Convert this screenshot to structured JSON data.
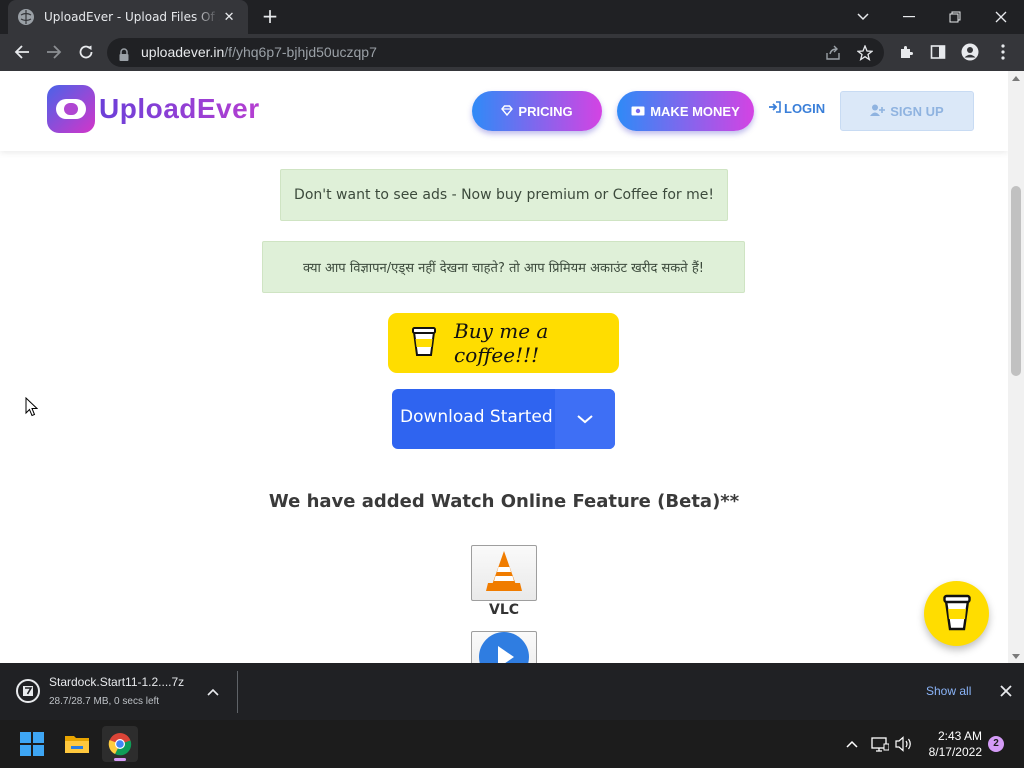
{
  "browser": {
    "tab_title": "UploadEver - Upload Files Of Any Size",
    "new_tab_symbol": "+",
    "tab_close_symbol": "✕",
    "url_host": "uploadever.in",
    "url_path": "/f/yhq6p7-bjhjd50uczqp7"
  },
  "site": {
    "logo_text": "UploadEver",
    "nav": {
      "pricing": "PRICING",
      "make_money": "MAKE MONEY",
      "login": "LOGIN",
      "signup": "SIGN UP"
    },
    "notice_en": "Don't want to see ads - Now buy premium or Coffee for me!",
    "notice_hi": "क्या आप विज्ञापन/एड्स नहीं देखना चाहते? तो आप प्रिमियम अकाउंट खरीद सकते हैं!",
    "coffee_button": "Buy me a coffee!!!",
    "download_button": "Download Started",
    "feature_heading": "We have added Watch Online Feature (Beta)**",
    "players": [
      {
        "label": "VLC",
        "icon": "vlc-cone-icon"
      },
      {
        "label": "",
        "icon": "play-circle-icon"
      }
    ]
  },
  "downloads": {
    "file_name": "Stardock.Start11-1.2....7z",
    "status": "28.7/28.7 MB, 0 secs left",
    "show_all": "Show all"
  },
  "taskbar": {
    "time": "2:43 AM",
    "date": "8/17/2022",
    "notification_count": "2"
  },
  "colors": {
    "brand_gradient_start": "#2f8af7",
    "brand_gradient_end": "#d443e3",
    "coffee_yellow": "#ffdd00",
    "download_blue": "#2f64f0",
    "notice_green": "#dff0d8",
    "login_blue": "#3a7fd9"
  }
}
